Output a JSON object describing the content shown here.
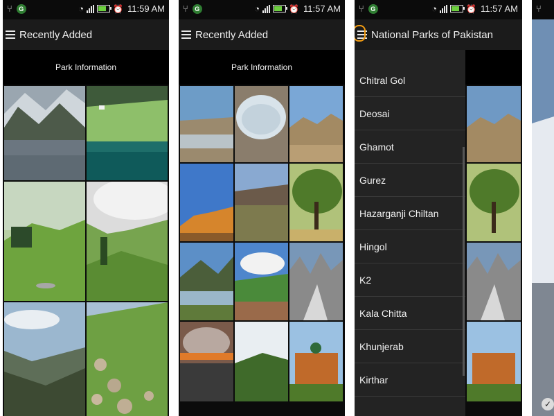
{
  "screens": [
    {
      "status": {
        "time": "11:59 AM"
      },
      "appbar": {
        "title": "Recently Added"
      },
      "subbar": {
        "label": "Park Information"
      }
    },
    {
      "status": {
        "time": "11:57 AM"
      },
      "appbar": {
        "title": "Recently Added"
      },
      "subbar": {
        "label": "Park Information"
      }
    },
    {
      "status": {
        "time": "11:57 AM"
      },
      "appbar": {
        "title": "National Parks of Pakistan"
      },
      "drawer": {
        "items": [
          "Chitral Gol",
          "Deosai",
          "Ghamot",
          "Gurez",
          "Hazarganji Chiltan",
          "Hingol",
          "K2",
          "Kala Chitta",
          "Khunjerab",
          "Kirthar"
        ]
      }
    }
  ],
  "colors": {
    "background": "#0b0b0b",
    "appbar": "#1b1b1b",
    "drawer": "#232323",
    "accent": "#f39c12"
  },
  "icons": [
    "usb-icon",
    "g-badge-icon",
    "wifi-icon",
    "signal-icon",
    "battery-icon",
    "alarm-icon",
    "menu-icon",
    "check-icon"
  ]
}
